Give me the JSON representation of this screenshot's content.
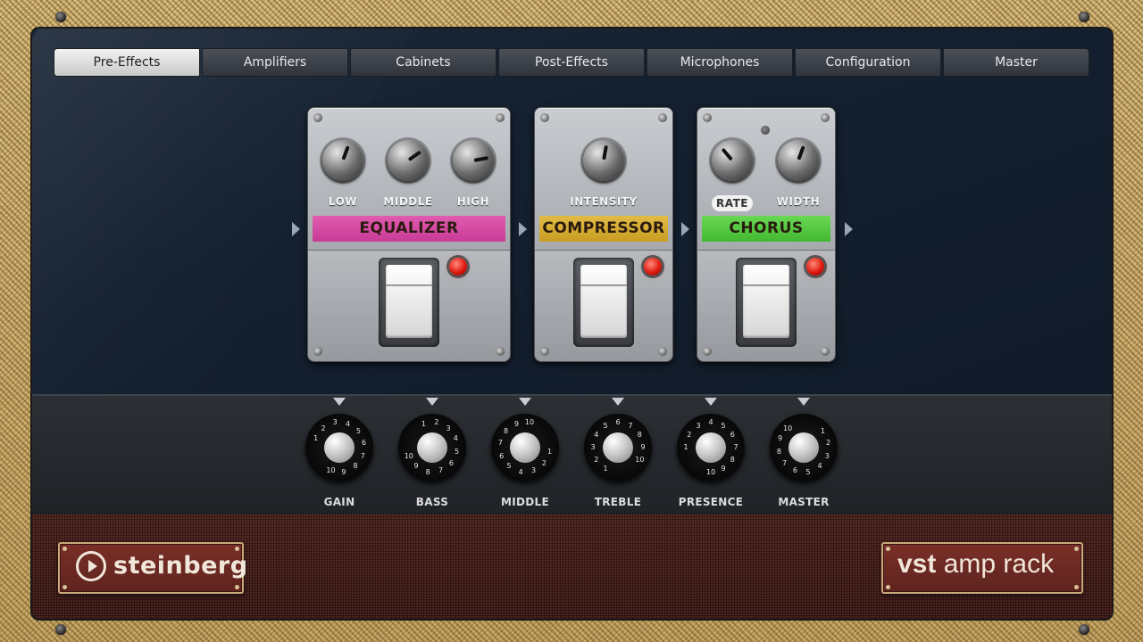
{
  "tabs": [
    {
      "label": "Pre-Effects",
      "active": true
    },
    {
      "label": "Amplifiers",
      "active": false
    },
    {
      "label": "Cabinets",
      "active": false
    },
    {
      "label": "Post-Effects",
      "active": false
    },
    {
      "label": "Microphones",
      "active": false
    },
    {
      "label": "Configuration",
      "active": false
    },
    {
      "label": "Master",
      "active": false
    }
  ],
  "pedals": {
    "equalizer": {
      "name": "EQUALIZER",
      "color": "#c83a96",
      "knobs": [
        "LOW",
        "MIDDLE",
        "HIGH"
      ]
    },
    "compressor": {
      "name": "COMPRESSOR",
      "color": "#d4a72c",
      "knobs": [
        "INTENSITY"
      ]
    },
    "chorus": {
      "name": "CHORUS",
      "color": "#4fc43c",
      "knobs": [
        "RATE",
        "WIDTH"
      ]
    }
  },
  "amp_controls": {
    "knobs": [
      "GAIN",
      "BASS",
      "MIDDLE",
      "TREBLE",
      "PRESENCE",
      "MASTER"
    ],
    "dial_numbers": [
      "1",
      "2",
      "3",
      "4",
      "5",
      "6",
      "7",
      "8",
      "9",
      "10"
    ]
  },
  "branding": {
    "left": "steinberg",
    "right_bold": "vst",
    "right_light": "amp rack"
  },
  "colors": {
    "led_on": "#e01a10",
    "tweed": "#d9be7e",
    "grille": "#5a2a24"
  }
}
